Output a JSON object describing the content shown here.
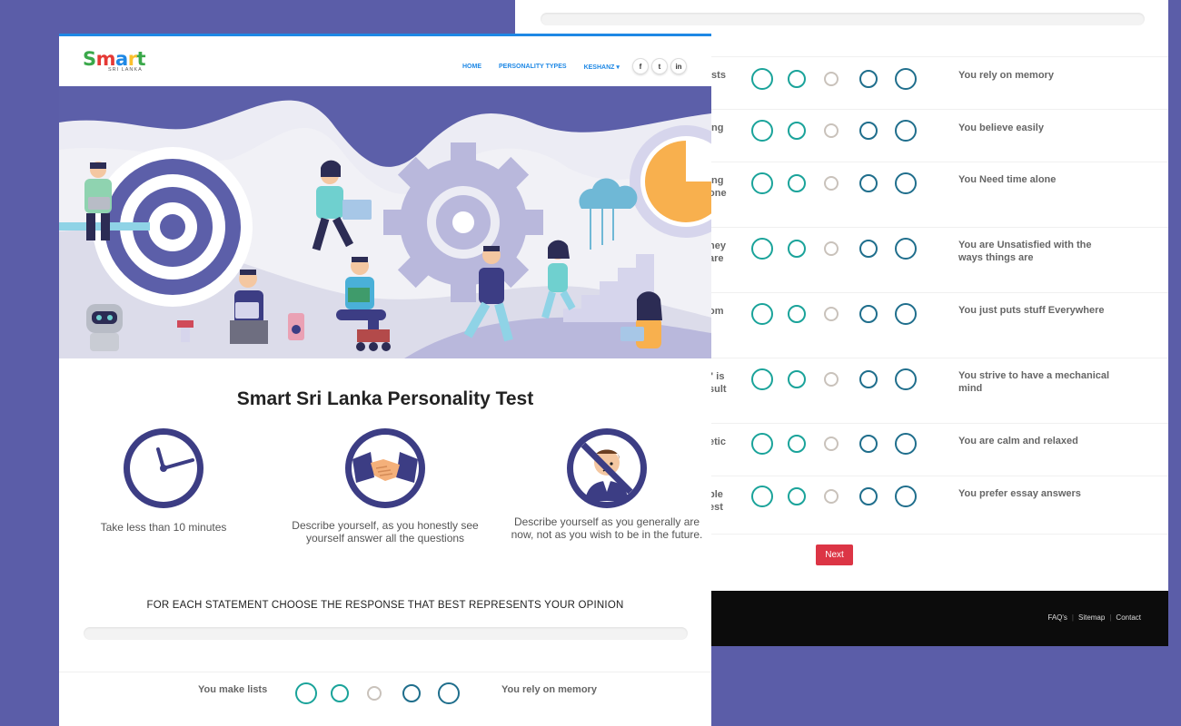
{
  "header": {
    "logo_text": "Smart",
    "logo_sub": "SRI LANKA",
    "menu": [
      "HOME",
      "PERSONALITY TYPES",
      "KESHANZ ▾"
    ],
    "socials": [
      "f",
      "t",
      "in"
    ]
  },
  "main": {
    "title": "Smart Sri Lanka Personality Test",
    "features": [
      {
        "icon": "clock-icon",
        "caption": "Take less than 10 minutes"
      },
      {
        "icon": "handshake-icon",
        "caption": "Describe yourself, as you honestly see yourself answer all the questions"
      },
      {
        "icon": "no-wishing-icon",
        "caption": "Describe yourself as you generally are now, not as you wish to be in the future."
      }
    ],
    "instruction": "FOR EACH STATEMENT CHOOSE THE RESPONSE THAT BEST REPRESENTS YOUR OPINION",
    "first_question": {
      "left": "You make lists",
      "right": "You rely on memory"
    }
  },
  "back": {
    "questions": [
      {
        "left": "ists",
        "right": "You rely on memory"
      },
      {
        "left": "ing",
        "right": "You believe easily"
      },
      {
        "left": "ing one",
        "right": "You Need time alone"
      },
      {
        "left": "ney are",
        "right": "You are Unsatisfied with the ways things are"
      },
      {
        "left": "om",
        "right": "You just puts stuff Everywhere"
      },
      {
        "left": "\" is sult",
        "right": "You strive to have a mechanical mind"
      },
      {
        "left": "etic",
        "right": "You are calm and relaxed"
      },
      {
        "left": "ple est",
        "right": "You prefer essay answers"
      }
    ],
    "next_label": "Next",
    "footer_links": [
      "FAQ's",
      "Sitemap",
      "Contact"
    ]
  },
  "colors": {
    "page_bg": "#5b5da8",
    "accent_blue": "#1e88e5",
    "teal": "#1aa39a",
    "dark_teal": "#1f6e8c",
    "next_red": "#dc3545"
  }
}
